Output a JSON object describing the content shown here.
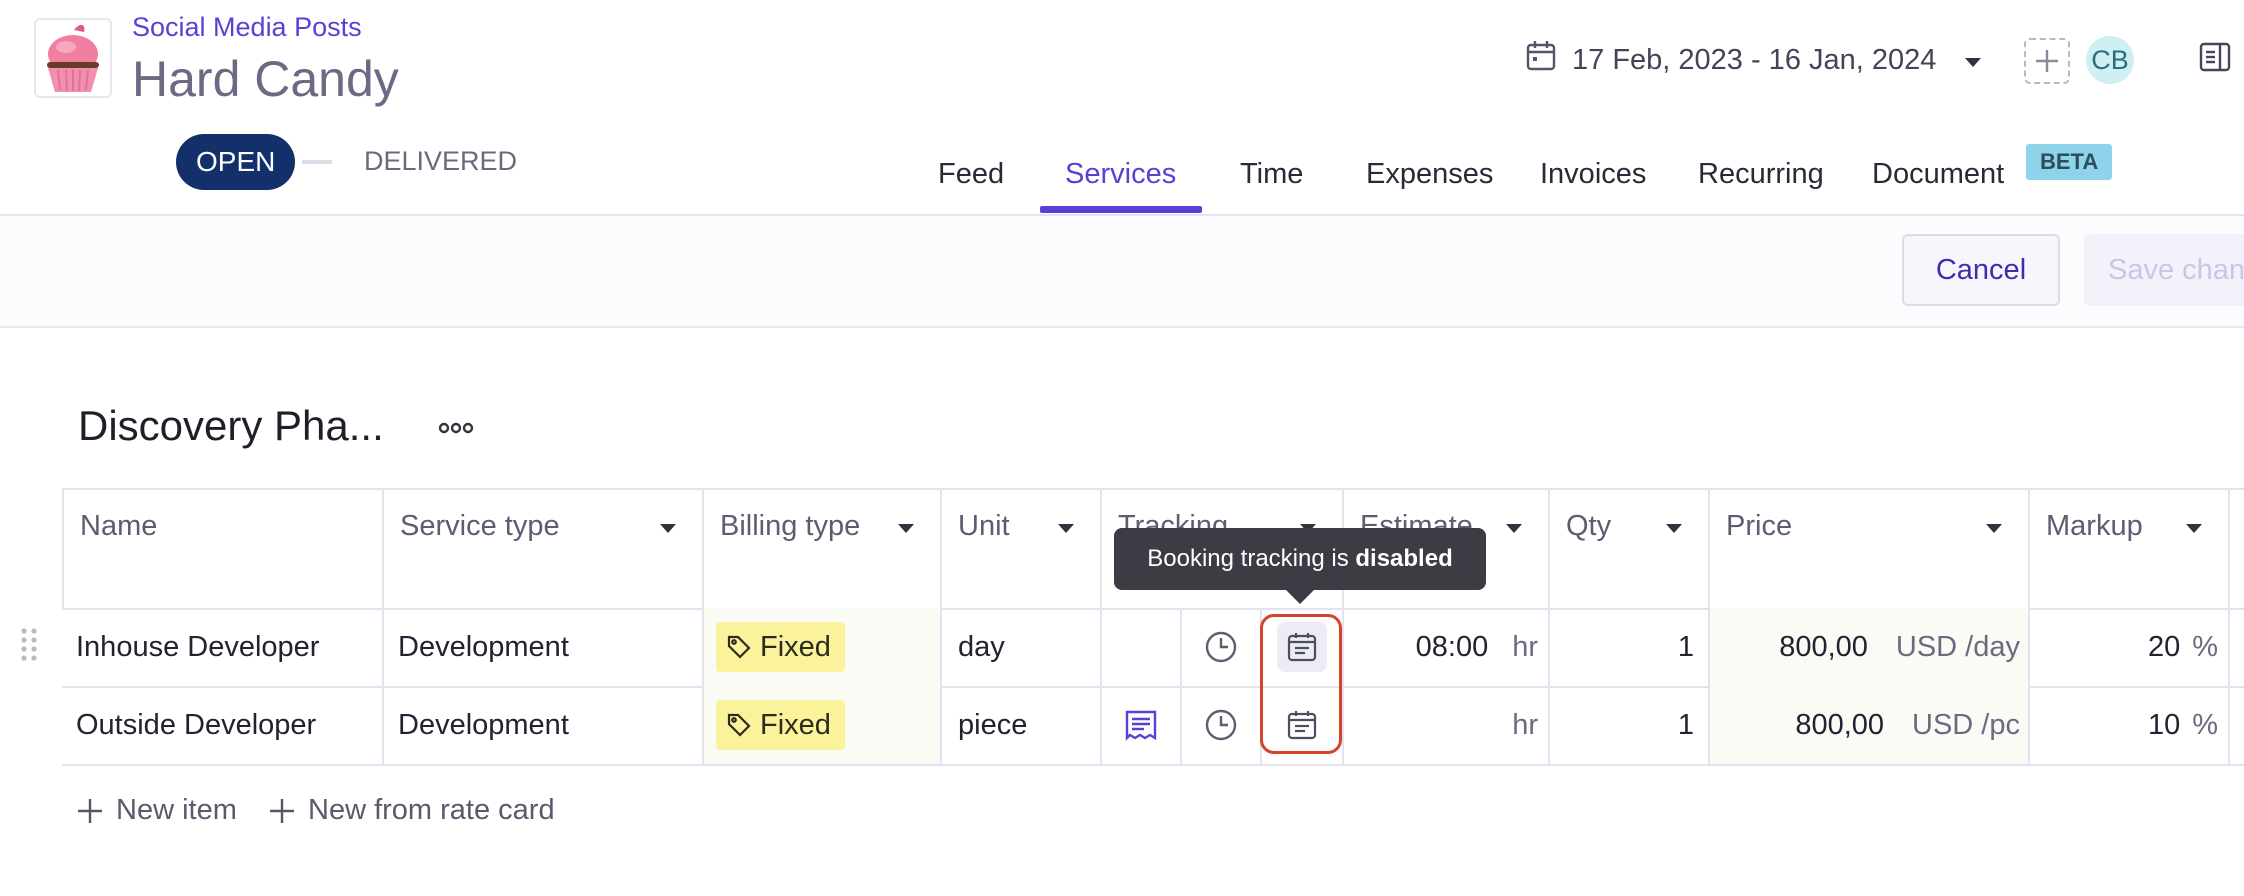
{
  "header": {
    "breadcrumb": "Social Media Posts",
    "title": "Hard Candy",
    "date_range": "17 Feb, 2023 - 16 Jan, 2024",
    "avatar_initials": "CB",
    "brand_color": "#5b3fd6"
  },
  "status": {
    "open": "OPEN",
    "delivered": "DELIVERED"
  },
  "tabs": [
    {
      "label": "Feed"
    },
    {
      "label": "Services",
      "active": true
    },
    {
      "label": "Time"
    },
    {
      "label": "Expenses"
    },
    {
      "label": "Invoices"
    },
    {
      "label": "Recurring"
    },
    {
      "label": "Document"
    }
  ],
  "beta_badge": "BETA",
  "toolbar": {
    "cancel_label": "Cancel",
    "save_label": "Save chan"
  },
  "section": {
    "title": "Discovery Pha..."
  },
  "table": {
    "columns": [
      "Name",
      "Service type",
      "Billing type",
      "Unit",
      "Tracking",
      "Estimate",
      "Qty",
      "Price",
      "Markup"
    ],
    "rows": [
      {
        "name": "Inhouse Developer",
        "service_type": "Development",
        "billing_type": "Fixed",
        "unit": "day",
        "estimate": "08:00",
        "estimate_unit": "hr",
        "qty": "1",
        "price": "800,00",
        "price_unit": "USD /day",
        "markup": "20",
        "markup_unit": "%"
      },
      {
        "name": "Outside Developer",
        "service_type": "Development",
        "billing_type": "Fixed",
        "unit": "piece",
        "estimate": "",
        "estimate_unit": "hr",
        "qty": "1",
        "price": "800,00",
        "price_unit": "USD /pc",
        "markup": "10",
        "markup_unit": "%"
      }
    ]
  },
  "tooltip": {
    "prefix": "Booking tracking is ",
    "emphasis": "disabled"
  },
  "actions": {
    "new_item": "New item",
    "new_from_rate_card": "New from rate card"
  }
}
